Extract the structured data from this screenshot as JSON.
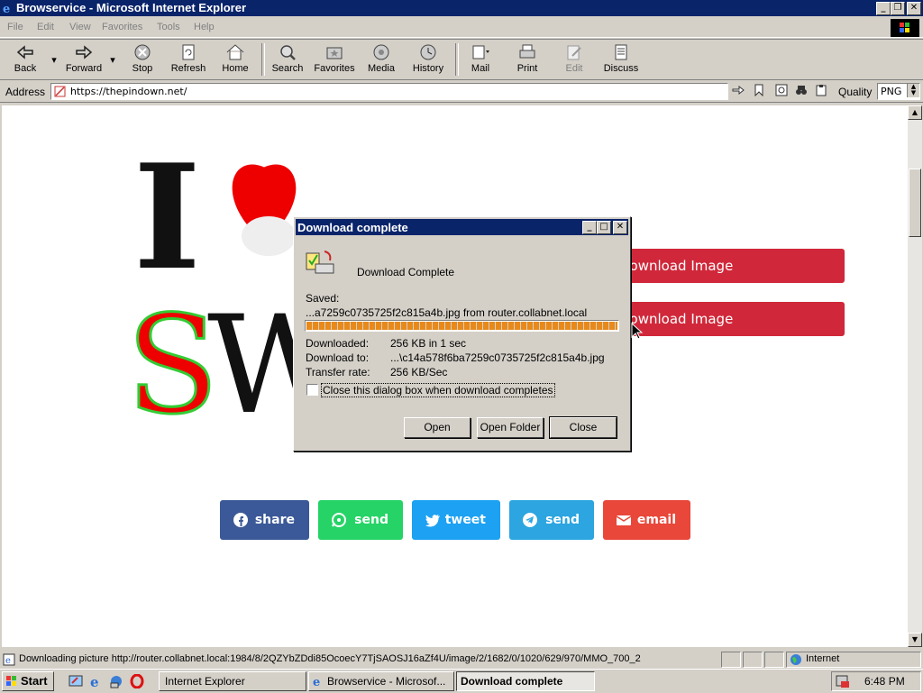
{
  "window": {
    "title": "Browservice - Microsoft Internet Explorer"
  },
  "menu": [
    "File",
    "Edit",
    "View",
    "Favorites",
    "Tools",
    "Help"
  ],
  "toolbar": {
    "back": "Back",
    "forward": "Forward",
    "stop": "Stop",
    "refresh": "Refresh",
    "home": "Home",
    "search": "Search",
    "favorites": "Favorites",
    "media": "Media",
    "history": "History",
    "mail": "Mail",
    "print": "Print",
    "edit": "Edit",
    "discuss": "Discuss"
  },
  "address": {
    "label": "Address",
    "url": "https://thepindown.net/",
    "quality_label": "Quality",
    "quality_value": "PNG"
  },
  "page": {
    "download_buttons": [
      "Download Image",
      "Download Image"
    ],
    "share_buttons": [
      {
        "label": "share",
        "color": "#3b5998",
        "icon": "facebook-icon"
      },
      {
        "label": "send",
        "color": "#25d366",
        "icon": "whatsapp-icon"
      },
      {
        "label": "tweet",
        "color": "#1da1f2",
        "icon": "twitter-icon"
      },
      {
        "label": "send",
        "color": "#2ca5e0",
        "icon": "telegram-icon"
      },
      {
        "label": "email",
        "color": "#e8473a",
        "icon": "envelope-icon"
      }
    ]
  },
  "dialog": {
    "title": "Download complete",
    "heading": "Download Complete",
    "saved_label": "Saved:",
    "saved_value": "...a7259c0735725f2c815a4b.jpg from router.collabnet.local",
    "progress": 1.0,
    "downloaded_label": "Downloaded:",
    "downloaded_value": "256 KB in 1 sec",
    "download_to_label": "Download to:",
    "download_to_value": "...\\c14a578f6ba7259c0735725f2c815a4b.jpg",
    "rate_label": "Transfer rate:",
    "rate_value": "256 KB/Sec",
    "checkbox_label": "Close this dialog box when download completes",
    "open": "Open",
    "open_folder": "Open Folder",
    "close": "Close"
  },
  "status": {
    "message": "Downloading picture http://router.collabnet.local:1984/8/2QZYbZDdi85OcoecY7TjSAOSJ16aZf4U/image/2/1682/0/1020/629/970/MMO_700_2",
    "zone": "Internet"
  },
  "taskbar": {
    "start": "Start",
    "items": [
      "Internet Explorer",
      "Browservice - Microsof...",
      "Download complete"
    ],
    "clock": "6:48 PM"
  }
}
